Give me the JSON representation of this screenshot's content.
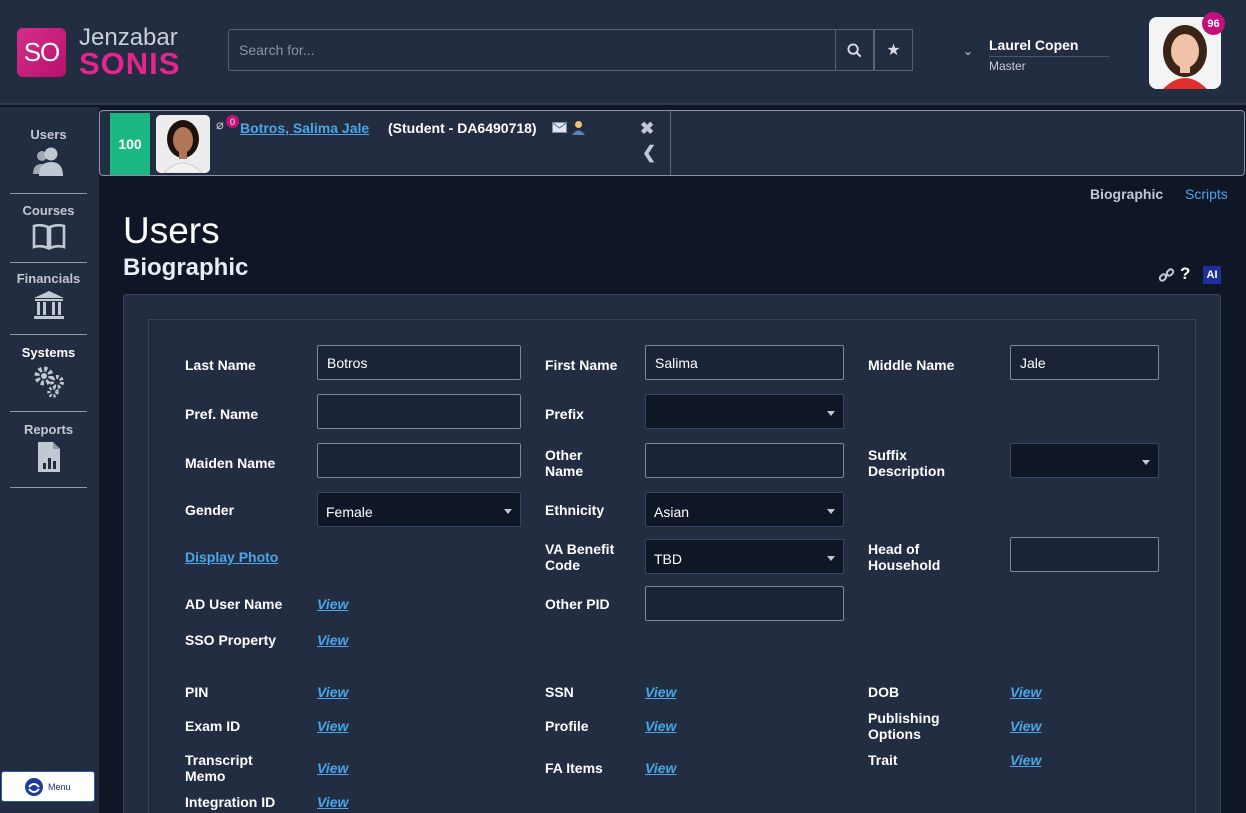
{
  "header": {
    "logo_mark": "SO",
    "logo_brand": "Jenzabar",
    "logo_product": "SONIS",
    "search_placeholder": "Search for...",
    "user_name": "Laurel Copen",
    "user_role": "Master",
    "notification_count": "96"
  },
  "sidebar": {
    "items": [
      {
        "label": "Users"
      },
      {
        "label": "Courses"
      },
      {
        "label": "Financials"
      },
      {
        "label": "Systems"
      },
      {
        "label": "Reports"
      }
    ],
    "menu_label": "Menu"
  },
  "student": {
    "score": "100",
    "attachment_count": "0",
    "name": "Botros, Salima Jale",
    "id_text": "(Student - DA6490718)"
  },
  "tabs": {
    "biographic": "Biographic",
    "scripts": "Scripts"
  },
  "page": {
    "title": "Users",
    "subtitle": "Biographic",
    "ai_label": "AI",
    "help_label": "?"
  },
  "form": {
    "last_name_label": "Last Name",
    "last_name": "Botros",
    "first_name_label": "First Name",
    "first_name": "Salima",
    "middle_name_label": "Middle Name",
    "middle_name": "Jale",
    "pref_name_label": "Pref. Name",
    "pref_name": "",
    "prefix_label": "Prefix",
    "prefix": "",
    "maiden_name_label": "Maiden Name",
    "maiden_name": "",
    "other_name_label": "Other Name",
    "other_name": "",
    "suffix_label": "Suffix Description",
    "suffix": "",
    "gender_label": "Gender",
    "gender": "Female",
    "ethnicity_label": "Ethnicity",
    "ethnicity": "Asian",
    "display_photo": "Display Photo",
    "va_label": "VA Benefit Code",
    "va_code": "TBD",
    "head_label": "Head of Household",
    "head": "",
    "ad_label": "AD User Name",
    "other_pid_label": "Other PID",
    "other_pid": "",
    "sso_label": "SSO Property",
    "pin_label": "PIN",
    "ssn_label": "SSN",
    "dob_label": "DOB",
    "exam_label": "Exam ID",
    "profile_label": "Profile",
    "publishing_label": "Publishing Options",
    "transcript_label": "Transcript Memo",
    "fa_label": "FA Items",
    "trait_label": "Trait",
    "integration_label": "Integration ID",
    "view_text": "View"
  },
  "colors": {
    "accent": "#4aa6e8",
    "brand": "#e6248b",
    "score": "#1cb884"
  }
}
